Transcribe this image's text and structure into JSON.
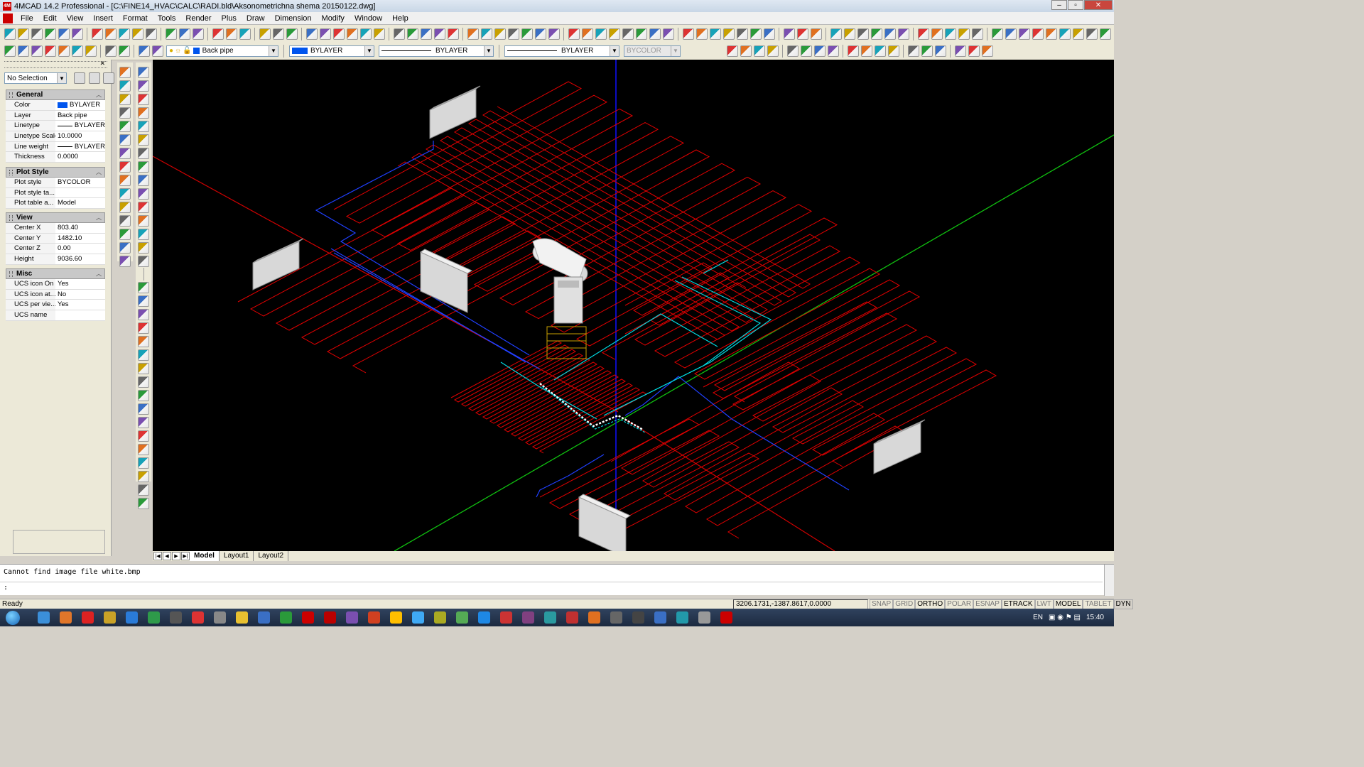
{
  "window": {
    "title": "4MCAD 14.2 Professional  - [C:\\FINE14_HVAC\\CALC\\RADI.bld\\Aksonometrichna shema 20150122.dwg]",
    "minimize": "–",
    "restore": "▫",
    "close": "✕"
  },
  "menu": [
    "File",
    "Edit",
    "View",
    "Insert",
    "Format",
    "Tools",
    "Render",
    "Plus",
    "Draw",
    "Dimension",
    "Modify",
    "Window",
    "Help"
  ],
  "layer_toolbar": {
    "layer": "Back pipe",
    "color": "BYLAYER",
    "linetype": "BYLAYER",
    "lineweight": "BYLAYER",
    "plotstyle": "BYCOLOR",
    "color_hex": "#0055ee"
  },
  "properties": {
    "selection": "No Selection",
    "sections": [
      {
        "title": "General",
        "rows": [
          {
            "k": "Color",
            "v": "BYLAYER"
          },
          {
            "k": "Layer",
            "v": "Back pipe"
          },
          {
            "k": "Linetype",
            "v": "BYLAYER"
          },
          {
            "k": "Linetype Scale",
            "v": "10.0000"
          },
          {
            "k": "Line weight",
            "v": "BYLAYER"
          },
          {
            "k": "Thickness",
            "v": "0.0000"
          }
        ]
      },
      {
        "title": "Plot Style",
        "rows": [
          {
            "k": "Plot style",
            "v": "BYCOLOR"
          },
          {
            "k": "Plot style ta...",
            "v": ""
          },
          {
            "k": "Plot table a...",
            "v": "Model"
          }
        ]
      },
      {
        "title": "View",
        "rows": [
          {
            "k": "Center X",
            "v": "803.40"
          },
          {
            "k": "Center Y",
            "v": "1482.10"
          },
          {
            "k": "Center Z",
            "v": "0.00"
          },
          {
            "k": "Height",
            "v": "9036.60"
          }
        ]
      },
      {
        "title": "Misc",
        "rows": [
          {
            "k": "UCS icon On",
            "v": "Yes"
          },
          {
            "k": "UCS icon at...",
            "v": "No"
          },
          {
            "k": "UCS per vie...",
            "v": "Yes"
          },
          {
            "k": "UCS name",
            "v": ""
          }
        ]
      }
    ]
  },
  "tabs": [
    "Model",
    "Layout1",
    "Layout2"
  ],
  "tab_nav": [
    "|◀",
    "◀",
    "▶",
    "▶|"
  ],
  "command": {
    "history": "Cannot find image file white.bmp",
    "prompt": ":"
  },
  "status": {
    "ready": "Ready",
    "coords": "3206.1731,-1387.8617,0.0000",
    "toggles": [
      "SNAP",
      "GRID",
      "ORTHO",
      "POLAR",
      "ESNAP",
      "ETRACK",
      "LWT",
      "MODEL",
      "TABLET",
      "DYN"
    ],
    "toggles_on": [
      "ORTHO",
      "ETRACK",
      "MODEL",
      "DYN"
    ]
  },
  "tray": {
    "lang": "EN",
    "clock": "15:40"
  },
  "colors": {
    "pipe_red": "#e00000",
    "pipe_blue": "#2040ff",
    "pipe_cyan": "#00d8e0",
    "axis_green": "#10c010",
    "axis_blue": "#1010ff"
  }
}
